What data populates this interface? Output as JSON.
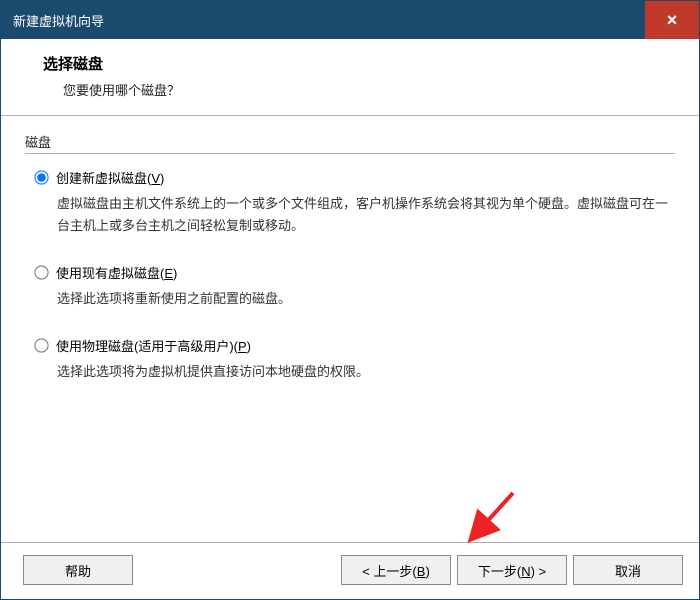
{
  "window": {
    "title": "新建虚拟机向导",
    "close_glyph": "×"
  },
  "header": {
    "title": "选择磁盘",
    "subtitle": "您要使用哪个磁盘？"
  },
  "group": {
    "label": "磁盘"
  },
  "options": {
    "create": {
      "label_pre": "创建新虚拟磁盘(",
      "hotkey": "V",
      "label_post": ")",
      "desc": "虚拟磁盘由主机文件系统上的一个或多个文件组成，客户机操作系统会将其视为单个硬盘。虚拟磁盘可在一台主机上或多台主机之间轻松复制或移动。",
      "checked": true
    },
    "existing": {
      "label_pre": "使用现有虚拟磁盘(",
      "hotkey": "E",
      "label_post": ")",
      "desc": "选择此选项将重新使用之前配置的磁盘。",
      "checked": false
    },
    "physical": {
      "label_pre": "使用物理磁盘(适用于高级用户)(",
      "hotkey": "P",
      "label_post": ")",
      "desc": "选择此选项将为虚拟机提供直接访问本地硬盘的权限。",
      "checked": false
    }
  },
  "buttons": {
    "help": "帮助",
    "back_pre": "< 上一步(",
    "back_key": "B",
    "back_post": ")",
    "next_pre": "下一步(",
    "next_key": "N",
    "next_post": ") >",
    "cancel": "取消"
  }
}
